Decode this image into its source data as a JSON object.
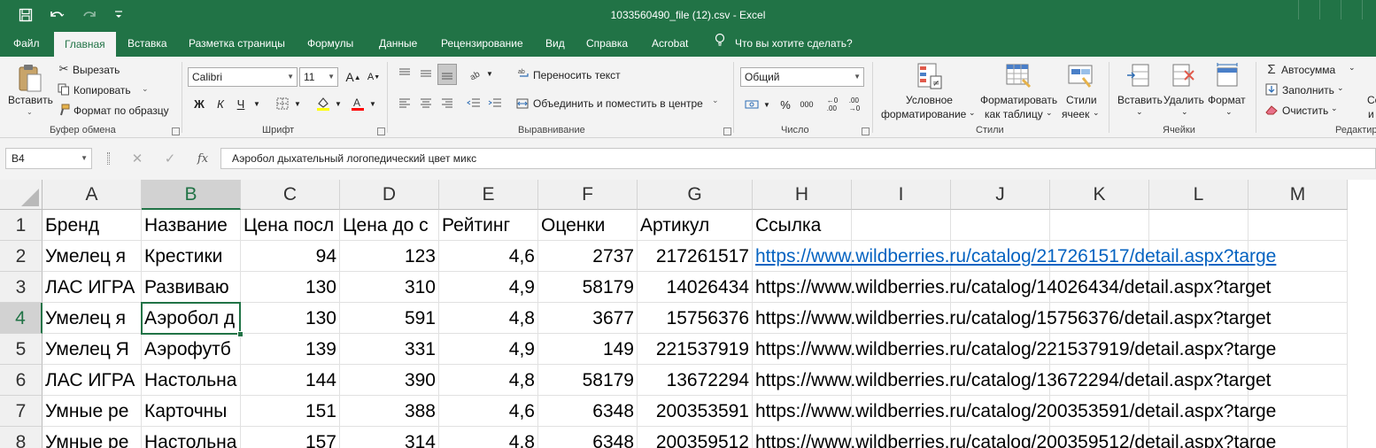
{
  "window": {
    "title": "1033560490_file (12).csv  -  Excel"
  },
  "qat": {
    "save_icon": "save-icon",
    "undo_icon": "undo-icon",
    "redo_icon": "redo-icon",
    "customize_icon": "customize-qat-icon"
  },
  "tabs": [
    {
      "label": "Файл"
    },
    {
      "label": "Главная"
    },
    {
      "label": "Вставка"
    },
    {
      "label": "Разметка страницы"
    },
    {
      "label": "Формулы"
    },
    {
      "label": "Данные"
    },
    {
      "label": "Рецензирование"
    },
    {
      "label": "Вид"
    },
    {
      "label": "Справка"
    },
    {
      "label": "Acrobat"
    }
  ],
  "tell_me": "Что вы хотите сделать?",
  "ribbon": {
    "clipboard": {
      "paste": "Вставить",
      "cut": "Вырезать",
      "copy": "Копировать",
      "format_painter": "Формат по образцу",
      "label": "Буфер обмена"
    },
    "font": {
      "name": "Calibri",
      "size": "11",
      "bold": "Ж",
      "italic": "К",
      "underline": "Ч",
      "label": "Шрифт",
      "highlight_color": "#ffff00",
      "font_color": "#ff0000"
    },
    "alignment": {
      "wrap": "Переносить текст",
      "merge": "Объединить и поместить в центре",
      "label": "Выравнивание"
    },
    "number": {
      "format": "Общий",
      "percent": "%",
      "thousands": "000",
      "label": "Число"
    },
    "styles": {
      "conditional_1": "Условное",
      "conditional_2": "форматирование",
      "as_table_1": "Форматировать",
      "as_table_2": "как таблицу",
      "cell_styles_1": "Стили",
      "cell_styles_2": "ячеек",
      "label": "Стили"
    },
    "cells": {
      "insert": "Вставить",
      "delete": "Удалить",
      "format": "Формат",
      "label": "Ячейки"
    },
    "editing": {
      "autosum": "Автосумма",
      "fill": "Заполнить",
      "clear": "Очистить",
      "label": "Редактир",
      "sort_1": "Со",
      "sort_2": "и"
    }
  },
  "formula_bar": {
    "name_box": "B4",
    "fx": "fx",
    "value": "Аэробол дыхательный логопедический цвет микс"
  },
  "columns": [
    "A",
    "B",
    "C",
    "D",
    "E",
    "F",
    "G",
    "H",
    "I",
    "J",
    "K",
    "L",
    "M"
  ],
  "rows": [
    {
      "num": "1",
      "cells": [
        "Бренд",
        "Название",
        "Цена посл",
        "Цена до с",
        "Рейтинг",
        "Оценки",
        "Артикул",
        "Ссылка"
      ]
    },
    {
      "num": "2",
      "cells": [
        "Умелец я",
        "Крестики",
        "94",
        "123",
        "4,6",
        "2737",
        "217261517",
        "https://www.wildberries.ru/catalog/217261517/detail.aspx?targe"
      ]
    },
    {
      "num": "3",
      "cells": [
        "ЛАС ИГРА",
        "Развиваю",
        "130",
        "310",
        "4,9",
        "58179",
        "14026434",
        "https://www.wildberries.ru/catalog/14026434/detail.aspx?target"
      ]
    },
    {
      "num": "4",
      "cells": [
        "Умелец я",
        "Аэробол д",
        "130",
        "591",
        "4,8",
        "3677",
        "15756376",
        "https://www.wildberries.ru/catalog/15756376/detail.aspx?target"
      ]
    },
    {
      "num": "5",
      "cells": [
        "Умелец Я",
        "Аэрофутб",
        "139",
        "331",
        "4,9",
        "149",
        "221537919",
        "https://www.wildberries.ru/catalog/221537919/detail.aspx?targe"
      ]
    },
    {
      "num": "6",
      "cells": [
        "ЛАС ИГРА",
        "Настольна",
        "144",
        "390",
        "4,8",
        "58179",
        "13672294",
        "https://www.wildberries.ru/catalog/13672294/detail.aspx?target"
      ]
    },
    {
      "num": "7",
      "cells": [
        "Умные ре",
        "Карточны",
        "151",
        "388",
        "4,6",
        "6348",
        "200353591",
        "https://www.wildberries.ru/catalog/200353591/detail.aspx?targe"
      ]
    },
    {
      "num": "8",
      "cells": [
        "Умные ре",
        "Настольна",
        "157",
        "314",
        "4,8",
        "6348",
        "200359512",
        "https://www.wildberries.ru/catalog/200359512/detail.aspx?targe"
      ]
    }
  ],
  "colors": {
    "accent": "#217346",
    "link": "#0563c1"
  }
}
